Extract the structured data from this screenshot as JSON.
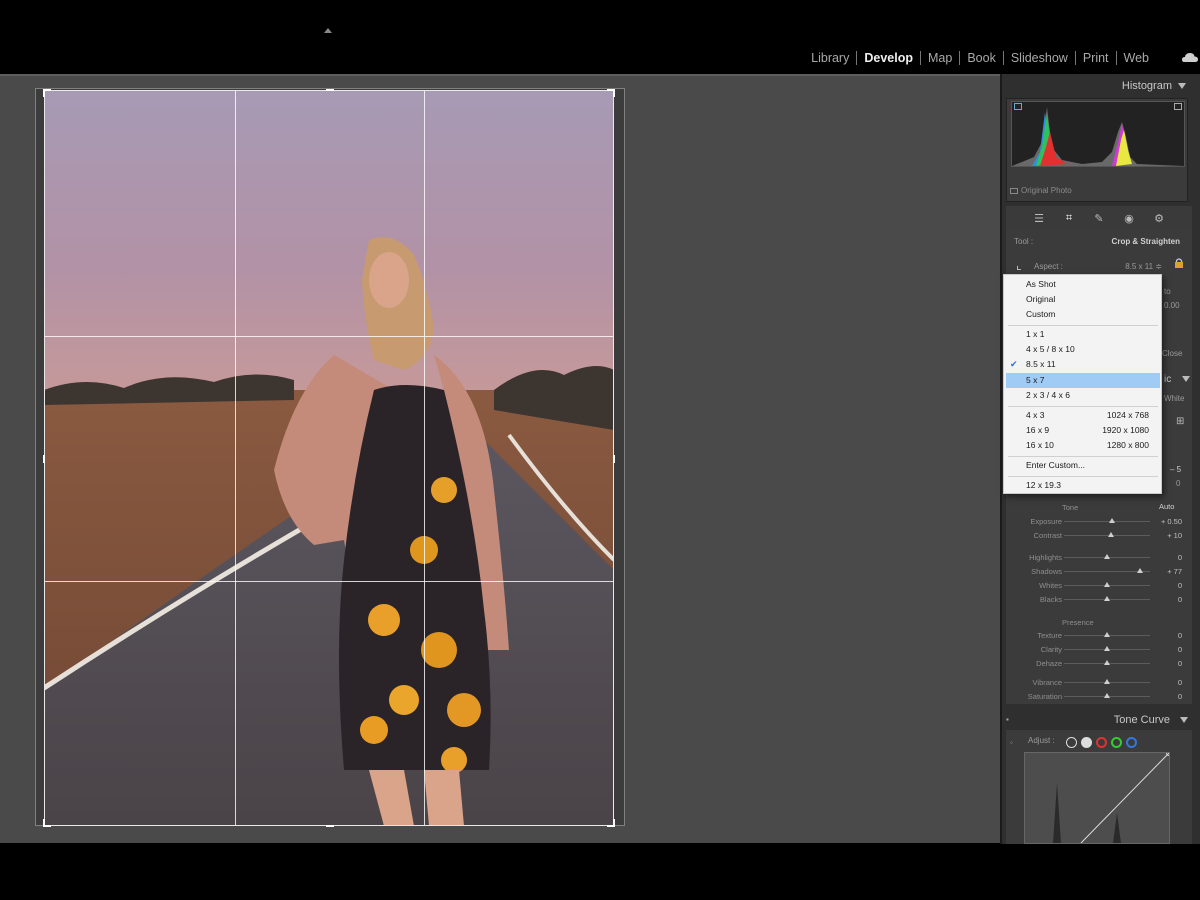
{
  "modules": [
    "Library",
    "Develop",
    "Map",
    "Book",
    "Slideshow",
    "Print",
    "Web"
  ],
  "active_module": "Develop",
  "histogram": {
    "title": "Histogram",
    "original_photo_label": "Original Photo"
  },
  "crop_panel": {
    "tool_label": "Tool :",
    "tool_name": "Crop & Straighten",
    "aspect_label": "Aspect :",
    "aspect_value": "8.5 x 11 ≑",
    "partial_auto": "to",
    "partial_angle": "0.00",
    "partial_close": "Close"
  },
  "aspect_menu": {
    "group1": [
      "As Shot",
      "Original",
      "Custom"
    ],
    "group2": [
      "1 x 1",
      "4 x 5  /  8 x 10",
      "8.5 x 11",
      "5 x 7",
      "2 x 3  /  4 x 6"
    ],
    "group3": [
      {
        "label": "4 x 3",
        "res": "1024 x 768"
      },
      {
        "label": "16 x 9",
        "res": "1920 x 1080"
      },
      {
        "label": "16 x 10",
        "res": "1280 x 800"
      }
    ],
    "enter_custom": "Enter Custom...",
    "recent": "12 x 19.3",
    "checked": "8.5 x 11",
    "highlighted": "5 x 7"
  },
  "basic_panel": {
    "partial_title": "ic",
    "partial_white": "White",
    "partial_temp": "– 5",
    "partial_tint": "0",
    "tone_label": "Tone",
    "auto_label": "Auto",
    "tone_sliders": [
      {
        "label": "Exposure",
        "value": "+ 0.50",
        "pos": 0.56
      },
      {
        "label": "Contrast",
        "value": "+ 10",
        "pos": 0.55
      },
      {
        "label": "Highlights",
        "value": "0",
        "pos": 0.5
      },
      {
        "label": "Shadows",
        "value": "+ 77",
        "pos": 0.88
      },
      {
        "label": "Whites",
        "value": "0",
        "pos": 0.5
      },
      {
        "label": "Blacks",
        "value": "0",
        "pos": 0.5
      }
    ],
    "presence_label": "Presence",
    "presence_sliders": [
      {
        "label": "Texture",
        "value": "0",
        "pos": 0.5
      },
      {
        "label": "Clarity",
        "value": "0",
        "pos": 0.5
      },
      {
        "label": "Dehaze",
        "value": "0",
        "pos": 0.5
      },
      {
        "label": "Vibrance",
        "value": "0",
        "pos": 0.5
      },
      {
        "label": "Saturation",
        "value": "0",
        "pos": 0.5
      }
    ]
  },
  "tone_curve": {
    "title": "Tone Curve",
    "adjust_label": "Adjust :"
  },
  "colors": {
    "accent_highlight": "#9fcbf5",
    "panel": "#3b3b3b",
    "workspace": "#4a4a4a"
  }
}
